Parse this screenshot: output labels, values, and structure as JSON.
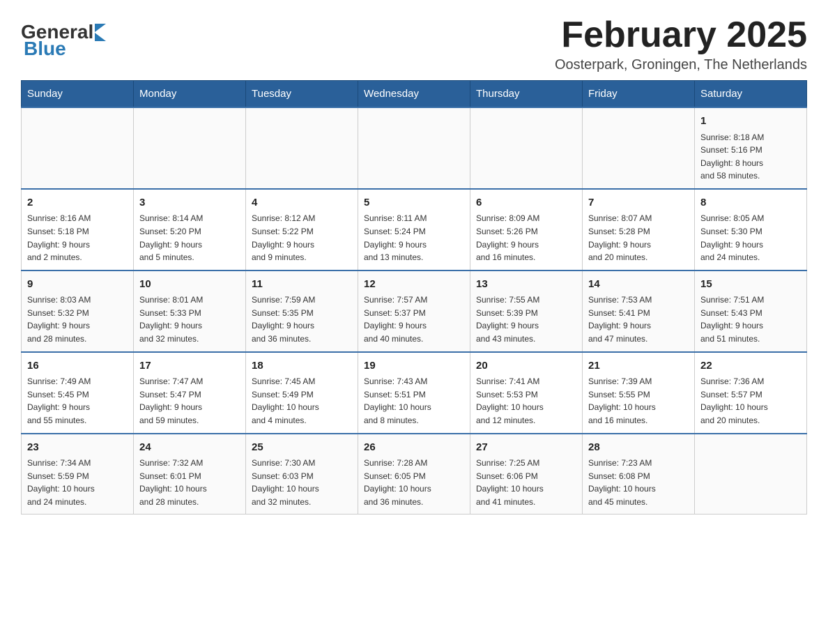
{
  "header": {
    "logo": {
      "general": "General",
      "blue": "Blue"
    },
    "title": "February 2025",
    "location": "Oosterpark, Groningen, The Netherlands"
  },
  "weekdays": [
    "Sunday",
    "Monday",
    "Tuesday",
    "Wednesday",
    "Thursday",
    "Friday",
    "Saturday"
  ],
  "weeks": [
    [
      {
        "day": "",
        "info": ""
      },
      {
        "day": "",
        "info": ""
      },
      {
        "day": "",
        "info": ""
      },
      {
        "day": "",
        "info": ""
      },
      {
        "day": "",
        "info": ""
      },
      {
        "day": "",
        "info": ""
      },
      {
        "day": "1",
        "info": "Sunrise: 8:18 AM\nSunset: 5:16 PM\nDaylight: 8 hours\nand 58 minutes."
      }
    ],
    [
      {
        "day": "2",
        "info": "Sunrise: 8:16 AM\nSunset: 5:18 PM\nDaylight: 9 hours\nand 2 minutes."
      },
      {
        "day": "3",
        "info": "Sunrise: 8:14 AM\nSunset: 5:20 PM\nDaylight: 9 hours\nand 5 minutes."
      },
      {
        "day": "4",
        "info": "Sunrise: 8:12 AM\nSunset: 5:22 PM\nDaylight: 9 hours\nand 9 minutes."
      },
      {
        "day": "5",
        "info": "Sunrise: 8:11 AM\nSunset: 5:24 PM\nDaylight: 9 hours\nand 13 minutes."
      },
      {
        "day": "6",
        "info": "Sunrise: 8:09 AM\nSunset: 5:26 PM\nDaylight: 9 hours\nand 16 minutes."
      },
      {
        "day": "7",
        "info": "Sunrise: 8:07 AM\nSunset: 5:28 PM\nDaylight: 9 hours\nand 20 minutes."
      },
      {
        "day": "8",
        "info": "Sunrise: 8:05 AM\nSunset: 5:30 PM\nDaylight: 9 hours\nand 24 minutes."
      }
    ],
    [
      {
        "day": "9",
        "info": "Sunrise: 8:03 AM\nSunset: 5:32 PM\nDaylight: 9 hours\nand 28 minutes."
      },
      {
        "day": "10",
        "info": "Sunrise: 8:01 AM\nSunset: 5:33 PM\nDaylight: 9 hours\nand 32 minutes."
      },
      {
        "day": "11",
        "info": "Sunrise: 7:59 AM\nSunset: 5:35 PM\nDaylight: 9 hours\nand 36 minutes."
      },
      {
        "day": "12",
        "info": "Sunrise: 7:57 AM\nSunset: 5:37 PM\nDaylight: 9 hours\nand 40 minutes."
      },
      {
        "day": "13",
        "info": "Sunrise: 7:55 AM\nSunset: 5:39 PM\nDaylight: 9 hours\nand 43 minutes."
      },
      {
        "day": "14",
        "info": "Sunrise: 7:53 AM\nSunset: 5:41 PM\nDaylight: 9 hours\nand 47 minutes."
      },
      {
        "day": "15",
        "info": "Sunrise: 7:51 AM\nSunset: 5:43 PM\nDaylight: 9 hours\nand 51 minutes."
      }
    ],
    [
      {
        "day": "16",
        "info": "Sunrise: 7:49 AM\nSunset: 5:45 PM\nDaylight: 9 hours\nand 55 minutes."
      },
      {
        "day": "17",
        "info": "Sunrise: 7:47 AM\nSunset: 5:47 PM\nDaylight: 9 hours\nand 59 minutes."
      },
      {
        "day": "18",
        "info": "Sunrise: 7:45 AM\nSunset: 5:49 PM\nDaylight: 10 hours\nand 4 minutes."
      },
      {
        "day": "19",
        "info": "Sunrise: 7:43 AM\nSunset: 5:51 PM\nDaylight: 10 hours\nand 8 minutes."
      },
      {
        "day": "20",
        "info": "Sunrise: 7:41 AM\nSunset: 5:53 PM\nDaylight: 10 hours\nand 12 minutes."
      },
      {
        "day": "21",
        "info": "Sunrise: 7:39 AM\nSunset: 5:55 PM\nDaylight: 10 hours\nand 16 minutes."
      },
      {
        "day": "22",
        "info": "Sunrise: 7:36 AM\nSunset: 5:57 PM\nDaylight: 10 hours\nand 20 minutes."
      }
    ],
    [
      {
        "day": "23",
        "info": "Sunrise: 7:34 AM\nSunset: 5:59 PM\nDaylight: 10 hours\nand 24 minutes."
      },
      {
        "day": "24",
        "info": "Sunrise: 7:32 AM\nSunset: 6:01 PM\nDaylight: 10 hours\nand 28 minutes."
      },
      {
        "day": "25",
        "info": "Sunrise: 7:30 AM\nSunset: 6:03 PM\nDaylight: 10 hours\nand 32 minutes."
      },
      {
        "day": "26",
        "info": "Sunrise: 7:28 AM\nSunset: 6:05 PM\nDaylight: 10 hours\nand 36 minutes."
      },
      {
        "day": "27",
        "info": "Sunrise: 7:25 AM\nSunset: 6:06 PM\nDaylight: 10 hours\nand 41 minutes."
      },
      {
        "day": "28",
        "info": "Sunrise: 7:23 AM\nSunset: 6:08 PM\nDaylight: 10 hours\nand 45 minutes."
      },
      {
        "day": "",
        "info": ""
      }
    ]
  ]
}
